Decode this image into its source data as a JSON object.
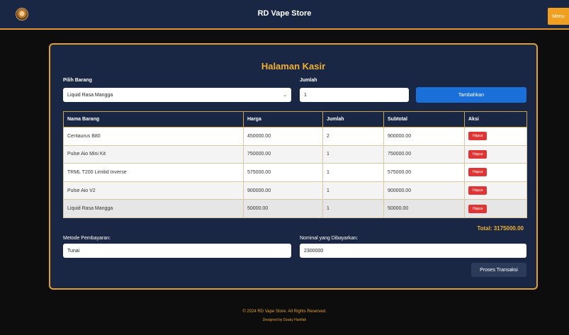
{
  "header": {
    "title": "RD Vape Store",
    "menu_label": "Menu",
    "logo_icon": "store-logo-icon"
  },
  "cashier": {
    "title": "Halaman Kasir",
    "item_label": "Pilih Barang",
    "item_selected": "Liquid Rasa Mangga",
    "qty_label": "Jumlah",
    "qty_value": "1",
    "add_button": "Tambahkan"
  },
  "table": {
    "headers": [
      "Nama Barang",
      "Harga",
      "Jumlah",
      "Subtotal",
      "Aksi"
    ],
    "rows": [
      {
        "name": "Centaurus B80",
        "price": "450000.00",
        "qty": "2",
        "subtotal": "900000.00",
        "action": "Hapus"
      },
      {
        "name": "Pulse Aio Mini Kit",
        "price": "750000.00",
        "qty": "1",
        "subtotal": "750000.00",
        "action": "Hapus"
      },
      {
        "name": "TRML T200 Limitid Inverse",
        "price": "575000.00",
        "qty": "1",
        "subtotal": "575000.00",
        "action": "Hapus"
      },
      {
        "name": "Pulse Aio V2",
        "price": "900000.00",
        "qty": "1",
        "subtotal": "900000.00",
        "action": "Hapus"
      },
      {
        "name": "Liquid Rasa Mangga",
        "price": "50000.00",
        "qty": "1",
        "subtotal": "50000.00",
        "action": "Hapus"
      }
    ]
  },
  "total": "Total: 3175000.00",
  "payment": {
    "method_label": "Metode Pembayaran:",
    "method_value": "Tunai",
    "paid_label": "Nominal yang Dibayarkan:",
    "paid_value": "2300000",
    "process_button": "Proses Transaksi"
  },
  "footer": {
    "copyright": "© 2024 RD Vape Store. All Rights Reserved.",
    "designed_by": "Designed by Dzaky Hanifah"
  },
  "colors": {
    "navy": "#1a2744",
    "accent": "#e0a030",
    "primary_button": "#1a6fd8",
    "delete_button": "#e03535"
  }
}
